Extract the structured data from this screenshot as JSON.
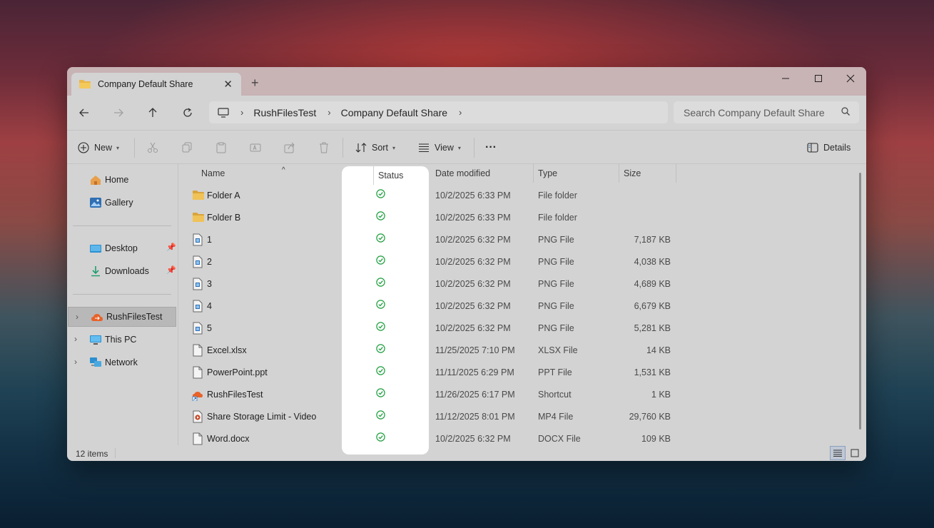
{
  "window": {
    "tab_title": "Company Default Share",
    "new_tab_label": "+"
  },
  "navigation": {
    "breadcrumb": [
      "RushFilesTest",
      "Company Default Share"
    ],
    "search_placeholder": "Search Company Default Share"
  },
  "toolbar": {
    "new_label": "New",
    "sort_label": "Sort",
    "view_label": "View",
    "more_label": "···",
    "details_label": "Details"
  },
  "sidebar": {
    "items": [
      {
        "label": "Home",
        "icon": "home-icon"
      },
      {
        "label": "Gallery",
        "icon": "gallery-icon"
      },
      {
        "label": "Desktop",
        "icon": "desktop-icon",
        "pinned": true
      },
      {
        "label": "Downloads",
        "icon": "downloads-icon",
        "pinned": true
      },
      {
        "label": "RushFilesTest",
        "icon": "rushfiles-cloud-icon",
        "selected": true
      },
      {
        "label": "This PC",
        "icon": "this-pc-icon"
      },
      {
        "label": "Network",
        "icon": "network-icon"
      }
    ]
  },
  "columns": {
    "name": "Name",
    "status": "Status",
    "date": "Date modified",
    "type": "Type",
    "size": "Size"
  },
  "files": [
    {
      "name": "Folder A",
      "date": "10/2/2025 6:33 PM",
      "type": "File folder",
      "size": "",
      "icon": "folder-icon"
    },
    {
      "name": "Folder B",
      "date": "10/2/2025 6:33 PM",
      "type": "File folder",
      "size": "",
      "icon": "folder-icon"
    },
    {
      "name": "1",
      "date": "10/2/2025 6:32 PM",
      "type": "PNG File",
      "size": "7,187 KB",
      "icon": "image-file-icon"
    },
    {
      "name": "2",
      "date": "10/2/2025 6:32 PM",
      "type": "PNG File",
      "size": "4,038 KB",
      "icon": "image-file-icon"
    },
    {
      "name": "3",
      "date": "10/2/2025 6:32 PM",
      "type": "PNG File",
      "size": "4,689 KB",
      "icon": "image-file-icon"
    },
    {
      "name": "4",
      "date": "10/2/2025 6:32 PM",
      "type": "PNG File",
      "size": "6,679 KB",
      "icon": "image-file-icon"
    },
    {
      "name": "5",
      "date": "10/2/2025 6:32 PM",
      "type": "PNG File",
      "size": "5,281 KB",
      "icon": "image-file-icon"
    },
    {
      "name": "Excel.xlsx",
      "date": "11/25/2025 7:10 PM",
      "type": "XLSX File",
      "size": "14 KB",
      "icon": "document-file-icon"
    },
    {
      "name": "PowerPoint.ppt",
      "date": "11/11/2025 6:29 PM",
      "type": "PPT File",
      "size": "1,531 KB",
      "icon": "document-file-icon"
    },
    {
      "name": "RushFilesTest",
      "date": "11/26/2025 6:17 PM",
      "type": "Shortcut",
      "size": "1 KB",
      "icon": "shortcut-icon"
    },
    {
      "name": "Share Storage Limit - Video",
      "date": "11/12/2025 8:01 PM",
      "type": "MP4 File",
      "size": "29,760 KB",
      "icon": "video-file-icon"
    },
    {
      "name": "Word.docx",
      "date": "10/2/2025 6:32 PM",
      "type": "DOCX File",
      "size": "109 KB",
      "icon": "document-file-icon"
    }
  ],
  "status_bar": {
    "item_count": "12 items"
  },
  "colors": {
    "synced_status": "#1e9e3e",
    "folder": "#e8b64a",
    "accent": "#2f6fb3"
  }
}
